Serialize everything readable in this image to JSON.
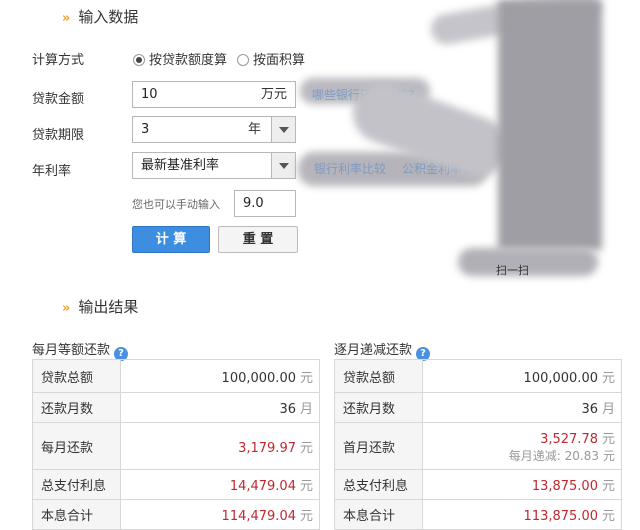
{
  "input_section": {
    "title": "输入数据",
    "calc_method_label": "计算方式",
    "calc_options": [
      "按贷款额度算",
      "按面积算"
    ],
    "loan_amount_label": "贷款金额",
    "loan_amount_value": "10",
    "loan_amount_unit": "万元",
    "loan_term_label": "贷款期限",
    "loan_term_value": "3",
    "loan_term_unit": "年",
    "rate_label": "年利率",
    "rate_value": "最新基准利率",
    "manual_hint": "您也可以手动输入",
    "manual_rate_value": "9.0",
    "calc_button": "计 算",
    "reset_button": "重 置",
    "link_repay": "哪些银行还款比较?",
    "link_rate_compare": "银行利率比较",
    "link_fund_rate": "公积金利率表",
    "qr_caption": "扫一扫"
  },
  "output_section": {
    "title": "输出结果",
    "equal_payment": {
      "title": "每月等额还款",
      "rows": [
        {
          "label": "贷款总额",
          "value": "100,000.00",
          "unit": "元",
          "red": false
        },
        {
          "label": "还款月数",
          "value": "36",
          "unit": "月",
          "red": false
        },
        {
          "label": "每月还款",
          "value": "3,179.97",
          "unit": "元",
          "red": true
        },
        {
          "label": "总支付利息",
          "value": "14,479.04",
          "unit": "元",
          "red": true
        },
        {
          "label": "本息合计",
          "value": "114,479.04",
          "unit": "元",
          "red": true
        }
      ]
    },
    "decreasing_payment": {
      "title": "逐月递减还款",
      "rows": [
        {
          "label": "贷款总额",
          "value": "100,000.00",
          "unit": "元",
          "red": false
        },
        {
          "label": "还款月数",
          "value": "36",
          "unit": "月",
          "red": false
        },
        {
          "label": "首月还款",
          "value": "3,527.78",
          "unit": "元",
          "red": true,
          "sub_label": "每月递减:",
          "sub_value": "20.83",
          "sub_unit": "元"
        },
        {
          "label": "总支付利息",
          "value": "13,875.00",
          "unit": "元",
          "red": true
        },
        {
          "label": "本息合计",
          "value": "113,875.00",
          "unit": "元",
          "red": true
        }
      ]
    }
  }
}
